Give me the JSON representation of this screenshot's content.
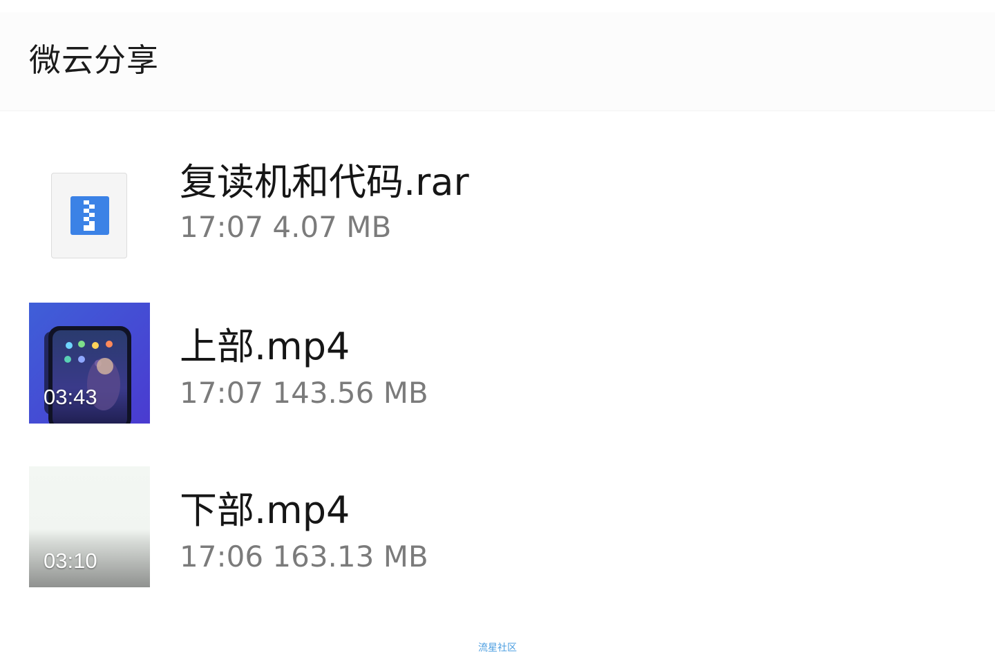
{
  "header": {
    "title": "微云分享"
  },
  "files": [
    {
      "name": "复读机和代码.rar",
      "time": "17:07",
      "size": "4.07 MB",
      "meta": "17:07 4.07 MB",
      "icon": "archive-icon"
    },
    {
      "name": "上部.mp4",
      "time": "17:07",
      "size": "143.56 MB",
      "meta": "17:07 143.56 MB",
      "duration": "03:43",
      "icon": "video-thumbnail"
    },
    {
      "name": "下部.mp4",
      "time": "17:06",
      "size": "163.13 MB",
      "meta": "17:06 163.13 MB",
      "duration": "03:10",
      "icon": "video-thumbnail"
    }
  ],
  "watermark": "流星社区",
  "colors": {
    "accent": "#3b82e6",
    "text_primary": "#161616",
    "text_secondary": "#7b7b7b",
    "watermark": "#4a9de0"
  }
}
